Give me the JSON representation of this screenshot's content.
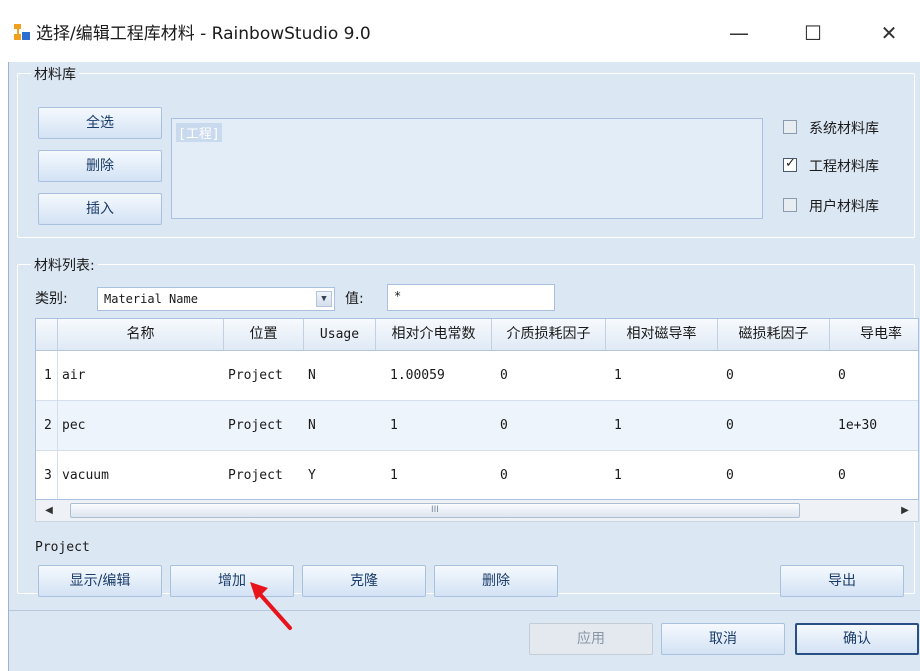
{
  "window": {
    "title": "选择/编辑工程库材料 - RainbowStudio 9.0",
    "minimize": "—",
    "maximize": "☐",
    "close": "✕"
  },
  "library": {
    "legend": "材料库",
    "buttons": [
      "全选",
      "删除",
      "插入"
    ],
    "list_items": [
      "[工程]"
    ],
    "checkboxes": [
      {
        "label": "系统材料库",
        "checked": false
      },
      {
        "label": "工程材料库",
        "checked": true
      },
      {
        "label": "用户材料库",
        "checked": false
      }
    ]
  },
  "materials": {
    "legend": "材料列表:",
    "filter": {
      "category_label": "类别:",
      "category_value": "Material Name",
      "value_label": "值:",
      "value": "*"
    },
    "columns": [
      "名称",
      "位置",
      "Usage",
      "相对介电常数",
      "介质损耗因子",
      "相对磁导率",
      "磁损耗因子",
      "导电率"
    ],
    "rows": [
      {
        "num": "1",
        "cells": [
          "air",
          "Project",
          "N",
          "1.00059",
          "0",
          "1",
          "0",
          "0"
        ]
      },
      {
        "num": "2",
        "cells": [
          "pec",
          "Project",
          "N",
          "1",
          "0",
          "1",
          "0",
          "1e+30"
        ]
      },
      {
        "num": "3",
        "cells": [
          "vacuum",
          "Project",
          "Y",
          "1",
          "0",
          "1",
          "0",
          "0"
        ]
      }
    ],
    "scroll_grip": "III",
    "status": "Project",
    "actions": [
      "显示/编辑",
      "增加",
      "克隆",
      "删除",
      "导出"
    ]
  },
  "footer": {
    "apply": "应用",
    "cancel": "取消",
    "ok": "确认"
  },
  "colors": {
    "client_bg": "#dce7f4",
    "button_text": "#1b3d6b",
    "annotation_arrow": "#e8141c"
  }
}
